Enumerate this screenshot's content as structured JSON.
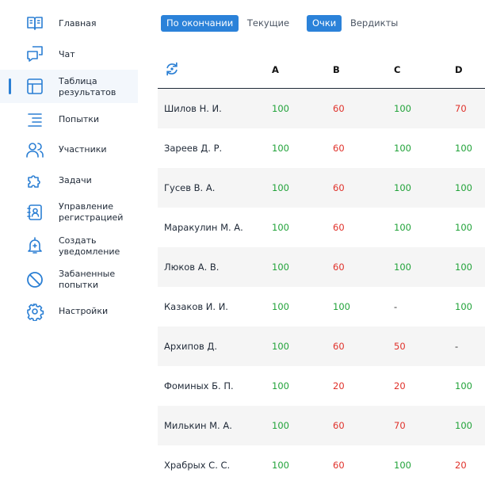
{
  "sidebar": {
    "items": [
      {
        "label": "Главная",
        "icon": "book-icon"
      },
      {
        "label": "Чат",
        "icon": "chat-icon"
      },
      {
        "label": "Таблица\nрезультатов",
        "icon": "table-icon",
        "active": true
      },
      {
        "label": "Попытки",
        "icon": "list-icon"
      },
      {
        "label": "Участники",
        "icon": "users-icon"
      },
      {
        "label": "Задачи",
        "icon": "puzzle-icon"
      },
      {
        "label": "Управление\nрегистрацией",
        "icon": "contact-book-icon"
      },
      {
        "label": "Создать\nуведомление",
        "icon": "bell-plus-icon"
      },
      {
        "label": "Забаненные\nпопытки",
        "icon": "ban-icon"
      },
      {
        "label": "Настройки",
        "icon": "gear-icon"
      }
    ]
  },
  "toggles": {
    "time": {
      "on": "По окончании",
      "off": "Текущие"
    },
    "mode": {
      "on": "Очки",
      "off": "Вердикты"
    }
  },
  "table": {
    "columns": [
      "A",
      "B",
      "C",
      "D"
    ],
    "rows": [
      {
        "name": "Шилов Н. И.",
        "scores": [
          "100",
          "60",
          "100",
          "70"
        ]
      },
      {
        "name": "Зареев Д. Р.",
        "scores": [
          "100",
          "60",
          "100",
          "100"
        ]
      },
      {
        "name": "Гусев В. А.",
        "scores": [
          "100",
          "60",
          "100",
          "100"
        ]
      },
      {
        "name": "Маракулин М. А.",
        "scores": [
          "100",
          "60",
          "100",
          "100"
        ]
      },
      {
        "name": "Люков А. В.",
        "scores": [
          "100",
          "60",
          "100",
          "100"
        ]
      },
      {
        "name": "Казаков И. И.",
        "scores": [
          "100",
          "100",
          "-",
          "100"
        ]
      },
      {
        "name": "Архипов Д.",
        "scores": [
          "100",
          "60",
          "50",
          "-"
        ]
      },
      {
        "name": "Фоминых Б. П.",
        "scores": [
          "100",
          "20",
          "20",
          "100"
        ]
      },
      {
        "name": "Милькин М. А.",
        "scores": [
          "100",
          "60",
          "70",
          "100"
        ]
      },
      {
        "name": "Храбрых С. С.",
        "scores": [
          "100",
          "60",
          "100",
          "20"
        ]
      }
    ]
  },
  "colors": {
    "accent": "#2b82d9",
    "full": "#22a33a",
    "partial": "#e0322b",
    "stripe": "#f5f5f5"
  }
}
